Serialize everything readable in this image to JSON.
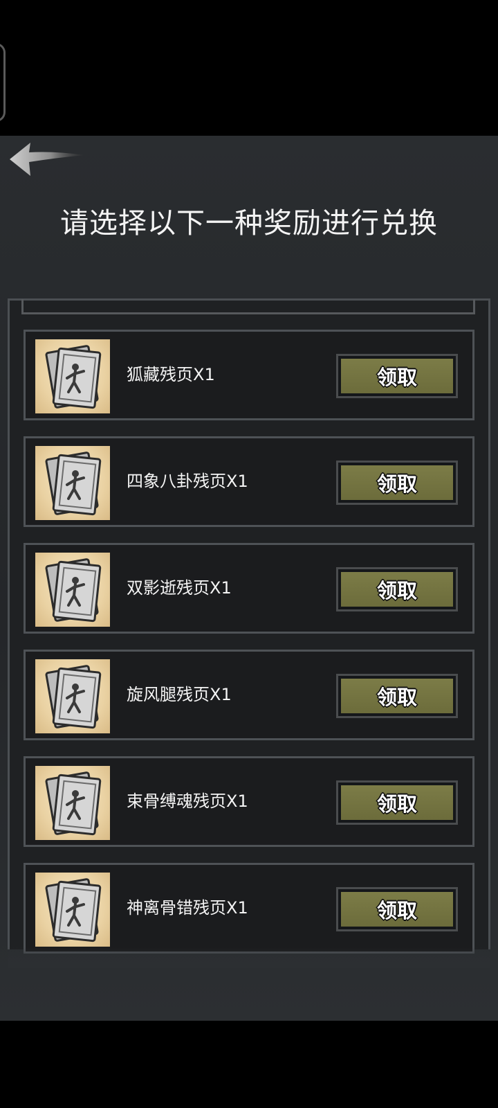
{
  "header": {
    "title": "请选择以下一种奖励进行兑换"
  },
  "icons": {
    "back": "back-arrow-icon",
    "item": "martial-art-scroll-icon"
  },
  "rewards": [
    {
      "name": "狐藏残页X1",
      "claim_label": "领取"
    },
    {
      "name": "四象八卦残页X1",
      "claim_label": "领取"
    },
    {
      "name": "双影逝残页X1",
      "claim_label": "领取"
    },
    {
      "name": "旋风腿残页X1",
      "claim_label": "领取"
    },
    {
      "name": "束骨缚魂残页X1",
      "claim_label": "领取"
    },
    {
      "name": "神离骨错残页X1",
      "claim_label": "领取"
    }
  ],
  "colors": {
    "button_fill": "#747441",
    "panel_bg": "#26282b",
    "border": "#4e5256"
  }
}
